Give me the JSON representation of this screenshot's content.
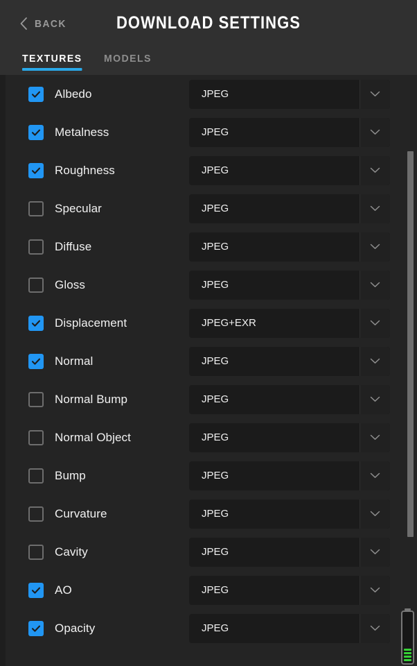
{
  "header": {
    "back_label": "BACK",
    "title": "DOWNLOAD SETTINGS",
    "back_icon": "chevron-left-icon"
  },
  "tabs": [
    {
      "label": "TEXTURES",
      "active": true
    },
    {
      "label": "MODELS",
      "active": false
    }
  ],
  "colors": {
    "accent": "#29a8e8",
    "checkbox_on": "#2196f3",
    "checkbox_off_border": "#6d6d6d",
    "header_bg": "#303030",
    "content_bg": "#242424",
    "select_bg": "#1b1b1b",
    "scrollbar": "#6e6e6e",
    "battery_green": "#35d135"
  },
  "texture_rows": [
    {
      "label": "Albedo",
      "checked": true,
      "format": "JPEG"
    },
    {
      "label": "Metalness",
      "checked": true,
      "format": "JPEG"
    },
    {
      "label": "Roughness",
      "checked": true,
      "format": "JPEG"
    },
    {
      "label": "Specular",
      "checked": false,
      "format": "JPEG"
    },
    {
      "label": "Diffuse",
      "checked": false,
      "format": "JPEG"
    },
    {
      "label": "Gloss",
      "checked": false,
      "format": "JPEG"
    },
    {
      "label": "Displacement",
      "checked": true,
      "format": "JPEG+EXR"
    },
    {
      "label": "Normal",
      "checked": true,
      "format": "JPEG"
    },
    {
      "label": "Normal Bump",
      "checked": false,
      "format": "JPEG"
    },
    {
      "label": "Normal Object",
      "checked": false,
      "format": "JPEG"
    },
    {
      "label": "Bump",
      "checked": false,
      "format": "JPEG"
    },
    {
      "label": "Curvature",
      "checked": false,
      "format": "JPEG"
    },
    {
      "label": "Cavity",
      "checked": false,
      "format": "JPEG"
    },
    {
      "label": "AO",
      "checked": true,
      "format": "JPEG"
    },
    {
      "label": "Opacity",
      "checked": true,
      "format": "JPEG"
    }
  ],
  "scrollbar": {
    "icon": "vertical-scrollbar"
  },
  "battery": {
    "icon": "battery-icon",
    "level_bars": 4
  }
}
